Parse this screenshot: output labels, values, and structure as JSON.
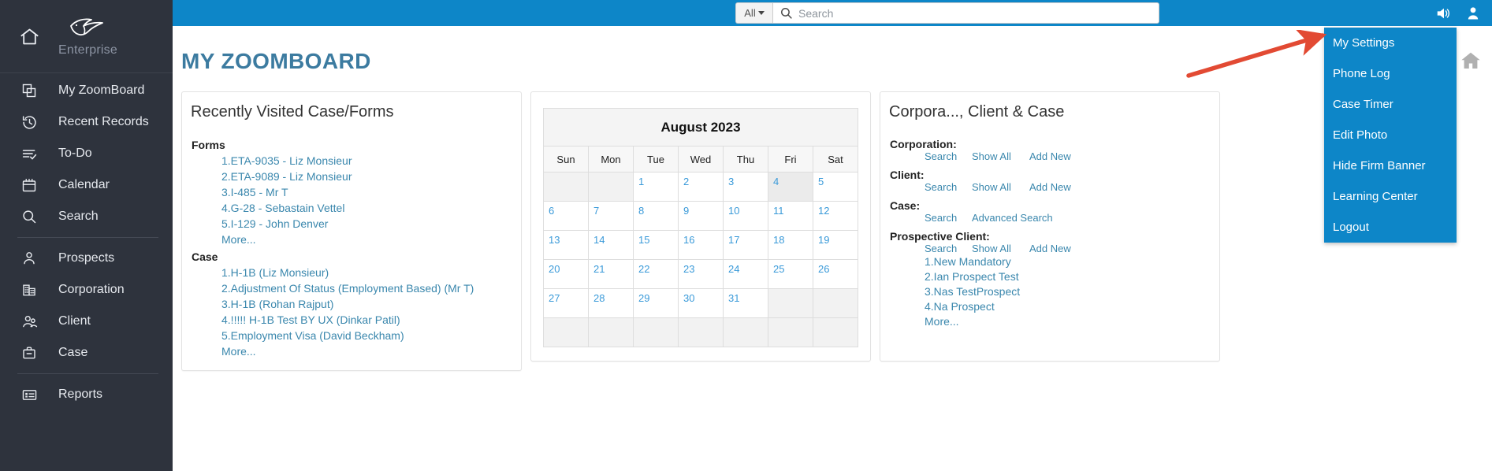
{
  "sidebar": {
    "brand": {
      "name": "Enterprise",
      "home_icon": "home-icon",
      "logo_icon": "bird-logo-icon"
    },
    "items": [
      {
        "label": "My ZoomBoard",
        "icon": "copy-windows-icon"
      },
      {
        "label": "Recent Records",
        "icon": "clock-history-icon"
      },
      {
        "label": "To-Do",
        "icon": "checklist-icon"
      },
      {
        "label": "Calendar",
        "icon": "calendar-icon"
      },
      {
        "label": "Search",
        "icon": "magnifier-icon"
      },
      {
        "label": "Prospects",
        "icon": "person-icon"
      },
      {
        "label": "Corporation",
        "icon": "building-icon"
      },
      {
        "label": "Client",
        "icon": "people-icon"
      },
      {
        "label": "Case",
        "icon": "briefcase-icon"
      },
      {
        "label": "Reports",
        "icon": "report-list-icon"
      }
    ]
  },
  "topbar": {
    "scope_label": "All",
    "search_value": "",
    "search_placeholder": "Search",
    "search_icon": "search-icon",
    "speaker_icon": "speaker-icon",
    "user_icon": "user-avatar-icon",
    "bg_color": "#0d86c8"
  },
  "page": {
    "title": "MY ZOOMBOARD",
    "title_color": "#3c7ba0",
    "home_icon": "home-icon"
  },
  "recent_panel": {
    "title": "Recently Visited Case/Forms",
    "forms_label": "Forms",
    "forms": [
      "1.ETA-9035 - Liz Monsieur",
      "2.ETA-9089 - Liz Monsieur",
      "3.I-485 - Mr T",
      "4.G-28 - Sebastain Vettel",
      "5.I-129 - John Denver",
      "More..."
    ],
    "case_label": "Case",
    "cases": [
      "1.H-1B (Liz Monsieur)",
      "2.Adjustment Of Status (Employment Based) (Mr T)",
      "3.H-1B (Rohan Rajput)",
      "4.!!!!! H-1B Test BY UX (Dinkar Patil)",
      "5.Employment Visa (David Beckham)",
      "More..."
    ]
  },
  "calendar": {
    "month_title": "August 2023",
    "dow": [
      "Sun",
      "Mon",
      "Tue",
      "Wed",
      "Thu",
      "Fri",
      "Sat"
    ],
    "today": "4",
    "weeks": [
      [
        "",
        "",
        "1",
        "2",
        "3",
        "4",
        "5"
      ],
      [
        "6",
        "7",
        "8",
        "9",
        "10",
        "11",
        "12"
      ],
      [
        "13",
        "14",
        "15",
        "16",
        "17",
        "18",
        "19"
      ],
      [
        "20",
        "21",
        "22",
        "23",
        "24",
        "25",
        "26"
      ],
      [
        "27",
        "28",
        "29",
        "30",
        "31",
        "",
        ""
      ],
      [
        "",
        "",
        "",
        "",
        "",
        "",
        ""
      ]
    ]
  },
  "corp_panel": {
    "title": "Corpora..., Client & Case",
    "sections": [
      {
        "label": "Corporation:",
        "actions": [
          "Search",
          "Show All",
          "Add New"
        ]
      },
      {
        "label": "Client:",
        "actions": [
          "Search",
          "Show All",
          "Add New"
        ]
      },
      {
        "label": "Case:",
        "actions": [
          "Search",
          "Advanced Search"
        ]
      },
      {
        "label": "Prospective Client:",
        "actions": [
          "Search",
          "Show All",
          "Add New"
        ]
      }
    ],
    "prospects": [
      "1.New Mandatory",
      "2.Ian Prospect Test",
      "3.Nas TestProspect",
      "4.Na Prospect",
      "More..."
    ]
  },
  "dropdown": {
    "bg_color": "#0d86c8",
    "items": [
      "My Settings",
      "Phone Log",
      "Case Timer",
      "Edit Photo",
      "Hide Firm Banner",
      "Learning Center",
      "Logout"
    ]
  },
  "annotation": {
    "arrow_color": "#e24a33",
    "points_to": "My Settings"
  }
}
